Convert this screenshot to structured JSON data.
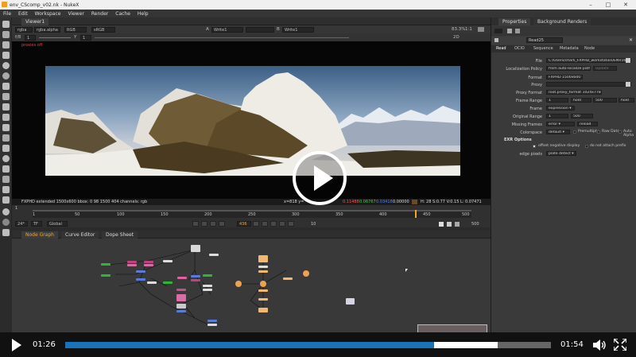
{
  "window": {
    "title": "env_CScomp_v02.nk - NukeX"
  },
  "menu": [
    "File",
    "Edit",
    "Workspace",
    "Viewer",
    "Render",
    "Cache",
    "Help"
  ],
  "viewer": {
    "tab": "Viewer1",
    "channel_layer": "rgba",
    "channel": "rgba.alpha",
    "colorspace_a": "RGB",
    "colorspace_b": "sRGB",
    "input_a": "A",
    "input_a_node": "Write1",
    "input_b": "B",
    "input_b_node": "Write1",
    "gain": "1",
    "gain_label": "f/8",
    "gamma": "1",
    "gamma_label": "Y",
    "frame_label": "1:2",
    "zoom": "83.3%",
    "ratio": "1:1",
    "view_mode": "2D",
    "proxy_warning": "proxies off",
    "status_left": "FXPHD extended 1500x600  bbox: 0 98 1500 404 channels: rgb",
    "status_xy": "x=818 y=",
    "status_r": "0.11488",
    "status_g": "0.06767",
    "status_b": "0.03418",
    "status_a": "0.00000",
    "status_hsvl": "H: 28 S:0.77 V:0.15  L: 0.07471"
  },
  "timeline": {
    "ticks": [
      "1",
      "50",
      "100",
      "150",
      "200",
      "250",
      "300",
      "350",
      "400",
      "450",
      "500"
    ],
    "fps": "24*",
    "tf": "TF",
    "range_mode": "Global",
    "current_frame": "436",
    "increment": "10",
    "end_frame": "500",
    "start_frame": "1",
    "playhead_fraction": 0.872
  },
  "dag_tabs": [
    "Node Graph",
    "Curve Editor",
    "Dope Sheet"
  ],
  "properties": {
    "tabs": [
      "Properties",
      "Background Renders"
    ],
    "node_name": "Read25",
    "subtabs": [
      "Read",
      "OCIO",
      "Sequence",
      "Metadata",
      "Node"
    ],
    "rows": [
      {
        "label": "File",
        "value": "C:/Users/charli_FXPHD_workstation/ENV162/"
      },
      {
        "label": "Localization Policy",
        "value": "from auto-localize path",
        "button": "Update"
      },
      {
        "label": "Format",
        "value": "FXPHD 1500x600 ▾"
      },
      {
        "label": "Proxy",
        "value": ""
      },
      {
        "label": "Proxy Format",
        "value": "root.proxy_format 1024x778 ▾"
      },
      {
        "label": "Frame Range",
        "value": "1",
        "extra": "hold",
        "value2": "500",
        "extra2": "hold"
      },
      {
        "label": "Frame",
        "value": "expression ▾"
      },
      {
        "label": "Original Range",
        "value": "1",
        "value2": "500"
      },
      {
        "label": "Missing Frames",
        "value": "error ▾",
        "button": "reload"
      },
      {
        "label": "Colorspace",
        "value": "default ▾",
        "checks": [
          "Premultiply",
          "Raw Data",
          "Auto Alpha"
        ]
      }
    ],
    "section": "EXR Options",
    "exr_checks": [
      "offset negative display",
      "do not attach prefix"
    ],
    "edge_pixels_label": "edge pixels",
    "edge_pixels_value": "plate detect ▾"
  },
  "player": {
    "elapsed": "01:26",
    "duration": "01:54",
    "progress_fraction": 0.76,
    "buffered_fraction": 0.89
  },
  "colors": {
    "accent": "#f5a623",
    "play_blue": "#1a73b8",
    "orange_node": "#f0a050",
    "green_node": "#2fb53a"
  },
  "icons": [
    "play-icon",
    "volume-icon",
    "fullscreen-icon",
    "close-icon",
    "minimize-icon",
    "maximize-icon"
  ]
}
